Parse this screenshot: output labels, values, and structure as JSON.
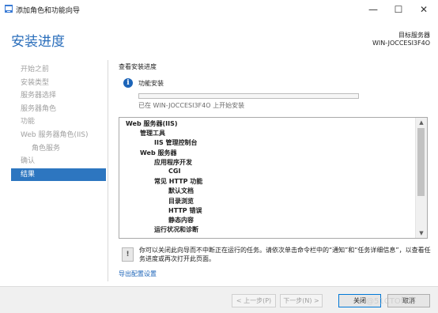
{
  "window": {
    "title": "添加角色和功能向导",
    "minimize_glyph": "—",
    "maximize_glyph": "☐",
    "close_glyph": "✕"
  },
  "header": {
    "page_title": "安装进度",
    "server_label": "目标服务器",
    "server_name": "WIN-JOCCESI3F4O"
  },
  "nav": {
    "items": [
      {
        "label": "开始之前",
        "state": "disabled"
      },
      {
        "label": "安装类型",
        "state": "disabled"
      },
      {
        "label": "服务器选择",
        "state": "disabled"
      },
      {
        "label": "服务器角色",
        "state": "disabled"
      },
      {
        "label": "功能",
        "state": "disabled"
      },
      {
        "label": "Web 服务器角色(IIS)",
        "state": "disabled"
      },
      {
        "label": "角色服务",
        "state": "disabled"
      },
      {
        "label": "确认",
        "state": "disabled"
      },
      {
        "label": "结果",
        "state": "active"
      }
    ]
  },
  "main": {
    "section_label": "查看安装进度",
    "info_icon_glyph": "i",
    "install_label": "功能安装",
    "progress_fraction": 0.0,
    "status_text": "已在 WIN-JOCCESI3F4O 上开始安装"
  },
  "tree": {
    "items": [
      {
        "label": "Web 服务器(IIS)",
        "level": 0
      },
      {
        "label": "管理工具",
        "level": 1
      },
      {
        "label": "IIS 管理控制台",
        "level": 2
      },
      {
        "label": "Web 服务器",
        "level": 1
      },
      {
        "label": "应用程序开发",
        "level": 2
      },
      {
        "label": "CGI",
        "level": 3
      },
      {
        "label": "常见 HTTP 功能",
        "level": 2
      },
      {
        "label": "默认文档",
        "level": 3
      },
      {
        "label": "目录浏览",
        "level": 3
      },
      {
        "label": "HTTP 错误",
        "level": 3
      },
      {
        "label": "静态内容",
        "level": 3
      },
      {
        "label": "运行状况和诊断",
        "level": 2
      }
    ],
    "scroll_up_glyph": "▲",
    "scroll_down_glyph": "▼"
  },
  "note": {
    "icon_glyph": "!",
    "text": "你可以关闭此向导而不中断正在运行的任务。请依次单击命令栏中的“通知”和“任务详细信息”，以查看任务进度或再次打开此页面。"
  },
  "export_link": "导出配置设置",
  "buttons": {
    "prev": "< 上一步(P)",
    "next": "下一步(N) >",
    "close": "关闭",
    "cancel": "取消"
  },
  "watermark": "@51CTO博客",
  "colors": {
    "accent": "#2d76c0",
    "title_blue": "#2a6ebb",
    "link_blue": "#1c64b8"
  }
}
